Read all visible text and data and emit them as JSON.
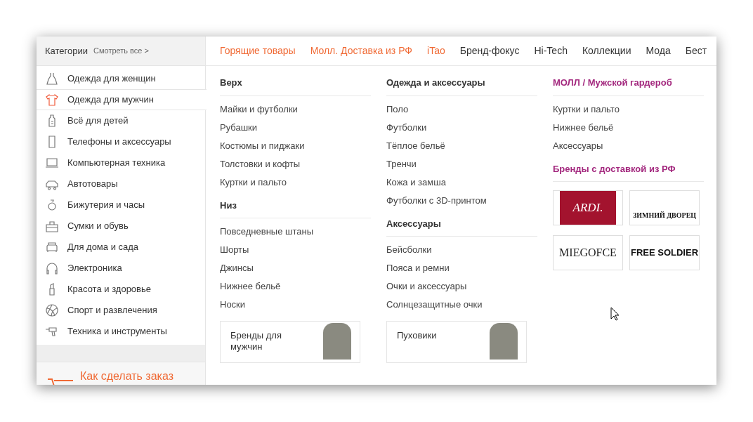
{
  "sidebar": {
    "title": "Категории",
    "see_all": "Смотреть все >",
    "items": [
      {
        "label": "Одежда для женщин",
        "selected": false
      },
      {
        "label": "Одежда для мужчин",
        "selected": true
      },
      {
        "label": "Всё для детей",
        "selected": false
      },
      {
        "label": "Телефоны и аксессуары",
        "selected": false
      },
      {
        "label": "Компьютерная техника",
        "selected": false
      },
      {
        "label": "Автотовары",
        "selected": false
      },
      {
        "label": "Бижутерия и часы",
        "selected": false
      },
      {
        "label": "Сумки и обувь",
        "selected": false
      },
      {
        "label": "Для дома и сада",
        "selected": false
      },
      {
        "label": "Электроника",
        "selected": false
      },
      {
        "label": "Красота и здоровье",
        "selected": false
      },
      {
        "label": "Спорт и развлечения",
        "selected": false
      },
      {
        "label": "Техника и инструменты",
        "selected": false
      }
    ],
    "how_to_order": "Как сделать заказ"
  },
  "nav": [
    {
      "label": "Горящие товары",
      "kind": "promo"
    },
    {
      "label": "Молл. Доставка из РФ",
      "kind": "promo"
    },
    {
      "label": "iTao",
      "kind": "promo"
    },
    {
      "label": "Бренд-фокус",
      "kind": "plain"
    },
    {
      "label": "Hi-Tech",
      "kind": "plain"
    },
    {
      "label": "Коллекции",
      "kind": "plain"
    },
    {
      "label": "Мода",
      "kind": "plain"
    },
    {
      "label": "Бест",
      "kind": "plain"
    }
  ],
  "columns": [
    {
      "sections": [
        {
          "title": "Верх",
          "kind": "plain",
          "links": [
            "Майки и футболки",
            "Рубашки",
            "Костюмы и пиджаки",
            "Толстовки и кофты",
            "Куртки и пальто"
          ]
        },
        {
          "title": "Низ",
          "kind": "plain",
          "links": [
            "Повседневные штаны",
            "Шорты",
            "Джинсы",
            "Нижнее бельё",
            "Носки"
          ]
        }
      ],
      "promo": "Бренды для мужчин"
    },
    {
      "sections": [
        {
          "title": "Одежда и аксессуары",
          "kind": "plain",
          "links": [
            "Поло",
            "Футболки",
            "Тёплое бельё",
            "Тренчи",
            "Кожа и замша",
            "Футболки с 3D-принтом"
          ]
        },
        {
          "title": "Аксессуары",
          "kind": "plain",
          "links": [
            "Бейсболки",
            "Пояса и ремни",
            "Очки и аксессуары",
            "Солнцезащитные очки"
          ]
        }
      ],
      "promo": "Пуховики"
    },
    {
      "sections": [
        {
          "title": "МОЛЛ / Мужской гардероб",
          "kind": "mall",
          "links": [
            "Куртки и пальто",
            "Нижнее бельё",
            "Аксессуары"
          ]
        },
        {
          "title": "Бренды с доставкой из РФ",
          "kind": "mall"
        }
      ],
      "brands": [
        "ARDI.",
        "ЗИМНИЙ ДВОРЕЦ",
        "MIEGOFCE",
        "FREE SOLDIER"
      ]
    }
  ]
}
